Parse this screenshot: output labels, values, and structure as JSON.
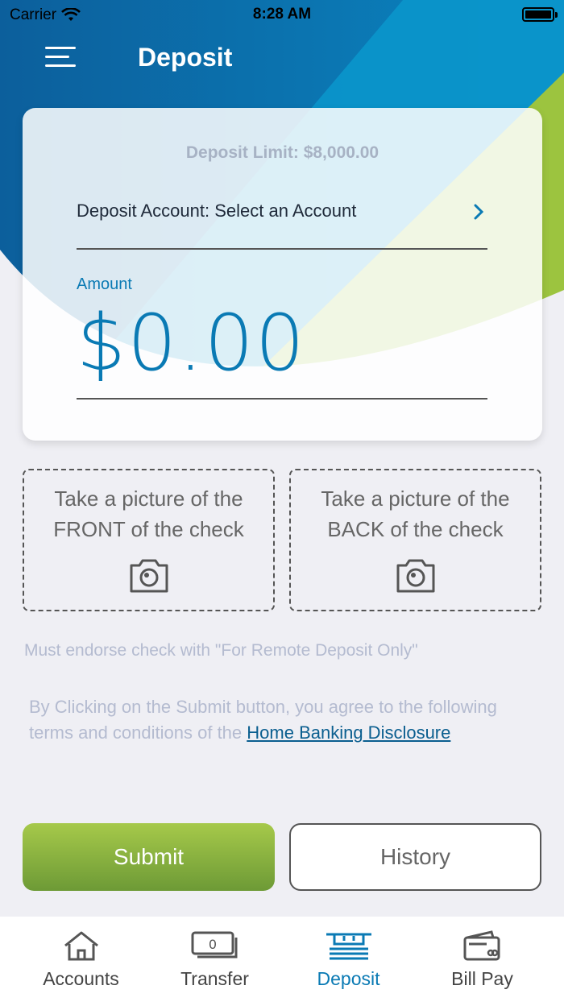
{
  "status_bar": {
    "carrier": "Carrier",
    "time": "8:28 AM"
  },
  "header": {
    "title": "Deposit",
    "menu_icon": "hamburger-menu-icon"
  },
  "card": {
    "deposit_limit_label": "Deposit Limit:  $8,000.00",
    "deposit_account_label": "Deposit Account: Select an Account",
    "amount_label": "Amount",
    "amount_value": "$0.00"
  },
  "capture": {
    "front_line1": "Take a picture of the",
    "front_line2": "FRONT of the check",
    "back_line1": "Take a picture of the",
    "back_line2": "BACK of the check"
  },
  "endorse_note": "Must endorse check with \"For Remote Deposit Only\"",
  "terms": {
    "text": "By Clicking on the Submit button, you agree to the following terms and conditions of the ",
    "link": "Home Banking Disclosure"
  },
  "buttons": {
    "submit": "Submit",
    "history": "History"
  },
  "tabs": [
    {
      "label": "Accounts",
      "icon": "house-icon"
    },
    {
      "label": "Transfer",
      "icon": "money-icon"
    },
    {
      "label": "Deposit",
      "icon": "deposit-icon",
      "active": true
    },
    {
      "label": "Bill Pay",
      "icon": "wallet-icon"
    }
  ],
  "colors": {
    "brand_blue": "#0a7ab4",
    "submit_green": "#8bb63f",
    "header_blue": "#0c6aa4"
  }
}
